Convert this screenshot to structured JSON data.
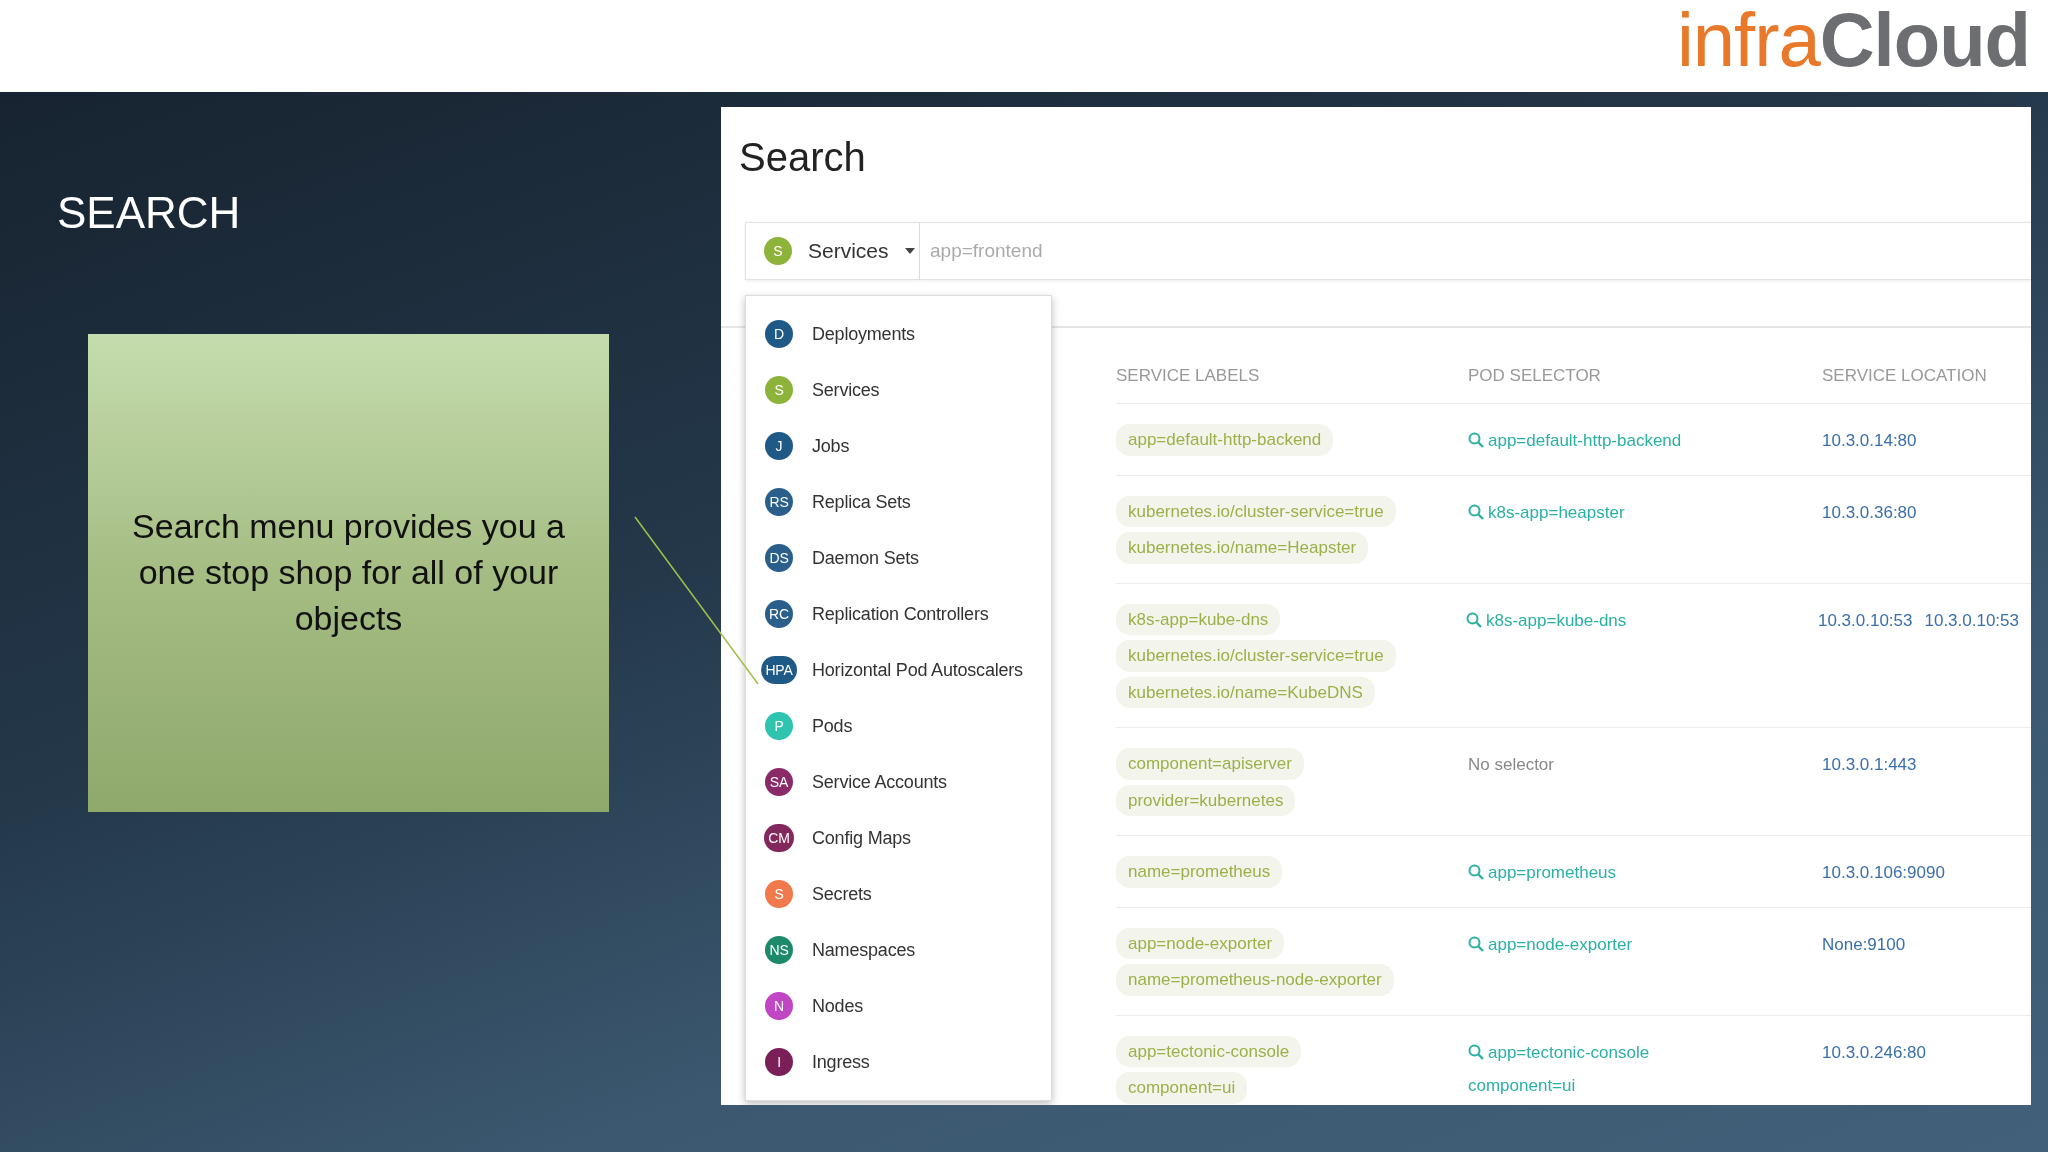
{
  "logo": {
    "part_1": "infra",
    "part_2": "Cloud"
  },
  "heading": "SEARCH",
  "callout": "Search menu provides you a one stop shop for all of your objects",
  "screenshot": {
    "title": "Search",
    "search": {
      "type": {
        "label": "Services",
        "badge": "S",
        "color": "#8db33b"
      },
      "placeholder": "app=frontend"
    },
    "menu": [
      {
        "badge": "D",
        "label": "Deployments",
        "color": "#1f5a86"
      },
      {
        "badge": "S",
        "label": "Services",
        "color": "#8db33b"
      },
      {
        "badge": "J",
        "label": "Jobs",
        "color": "#1f5a86"
      },
      {
        "badge": "RS",
        "label": "Replica Sets",
        "color": "#2a5f8c"
      },
      {
        "badge": "DS",
        "label": "Daemon Sets",
        "color": "#2a5f8c"
      },
      {
        "badge": "RC",
        "label": "Replication Controllers",
        "color": "#2a5f8c"
      },
      {
        "badge": "HPA",
        "label": "Horizontal Pod Autoscalers",
        "color": "#1f5a86"
      },
      {
        "badge": "P",
        "label": "Pods",
        "color": "#2ec4b0"
      },
      {
        "badge": "SA",
        "label": "Service Accounts",
        "color": "#8a2a68"
      },
      {
        "badge": "CM",
        "label": "Config Maps",
        "color": "#83285c"
      },
      {
        "badge": "S",
        "label": "Secrets",
        "color": "#f07a4c"
      },
      {
        "badge": "NS",
        "label": "Namespaces",
        "color": "#1e8a6c"
      },
      {
        "badge": "N",
        "label": "Nodes",
        "color": "#c046c4"
      },
      {
        "badge": "I",
        "label": "Ingress",
        "color": "#7a1f58"
      }
    ],
    "table": {
      "columns": [
        "SERVICE LABELS",
        "POD SELECTOR",
        "SERVICE LOCATION"
      ],
      "rows": [
        {
          "labels": [
            "app=default-http-backend"
          ],
          "selector": {
            "kind": "query",
            "lines": [
              "app=default-http-backend"
            ]
          },
          "locations": [
            "10.3.0.14:80"
          ]
        },
        {
          "labels": [
            "kubernetes.io/cluster-service=true",
            "kubernetes.io/name=Heapster"
          ],
          "selector": {
            "kind": "query",
            "lines": [
              "k8s-app=heapster"
            ]
          },
          "locations": [
            "10.3.0.36:80"
          ]
        },
        {
          "labels": [
            "k8s-app=kube-dns",
            "kubernetes.io/cluster-service=true",
            "kubernetes.io/name=KubeDNS"
          ],
          "selector": {
            "kind": "query",
            "lines": [
              "k8s-app=kube-dns"
            ]
          },
          "locations": [
            "10.3.0.10:53",
            "10.3.0.10:53"
          ]
        },
        {
          "labels": [
            "component=apiserver",
            "provider=kubernetes"
          ],
          "selector": {
            "kind": "none",
            "lines": [
              "No selector"
            ]
          },
          "locations": [
            "10.3.0.1:443"
          ]
        },
        {
          "labels": [
            "name=prometheus"
          ],
          "selector": {
            "kind": "query",
            "lines": [
              "app=prometheus"
            ]
          },
          "locations": [
            "10.3.0.106:9090"
          ]
        },
        {
          "labels": [
            "app=node-exporter",
            "name=prometheus-node-exporter"
          ],
          "selector": {
            "kind": "query",
            "lines": [
              "app=node-exporter"
            ]
          },
          "locations": [
            "None:9100"
          ]
        },
        {
          "labels": [
            "app=tectonic-console",
            "component=ui"
          ],
          "selector": {
            "kind": "query",
            "lines": [
              "app=tectonic-console",
              "component=ui"
            ]
          },
          "locations": [
            "10.3.0.246:80"
          ]
        }
      ]
    }
  }
}
